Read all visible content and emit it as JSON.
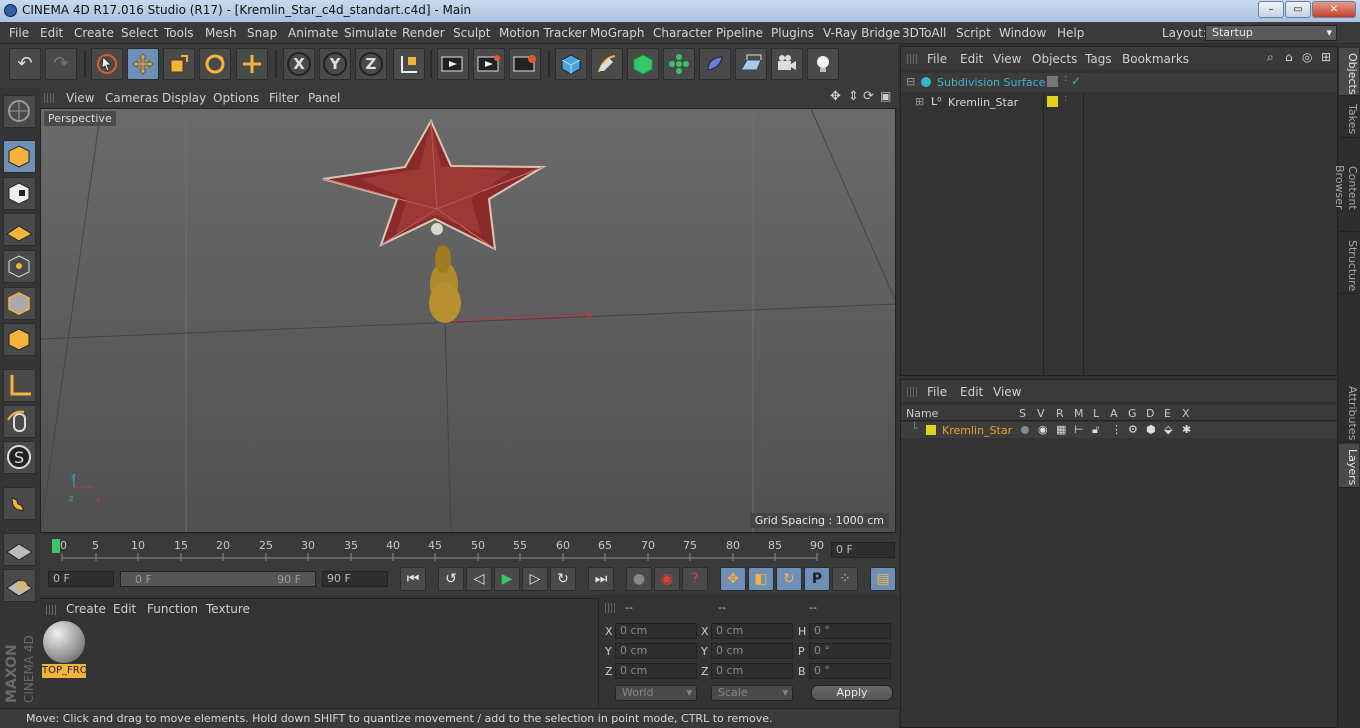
{
  "title": "CINEMA 4D R17.016 Studio (R17) - [Kremlin_Star_c4d_standart.c4d] - Main",
  "menu": [
    "File",
    "Edit",
    "Create",
    "Select",
    "Tools",
    "Mesh",
    "Snap",
    "Animate",
    "Simulate",
    "Render",
    "Sculpt",
    "Motion Tracker",
    "MoGraph",
    "Character",
    "Pipeline",
    "Plugins",
    "V-Ray Bridge",
    "3DToAll",
    "Script",
    "Window",
    "Help"
  ],
  "layout": {
    "label": "Layout:",
    "value": "Startup"
  },
  "toolbar_icons": [
    "undo-icon",
    "redo-icon",
    "live-selection-icon",
    "move-icon",
    "scale-icon",
    "rotate-icon",
    "recent-tool-icon",
    "x-axis-icon",
    "y-axis-icon",
    "z-axis-icon",
    "coordinate-system-icon",
    "render-view-icon",
    "render-picture-viewer-icon",
    "render-settings-icon",
    "cube-icon",
    "pen-icon",
    "subdivision-icon",
    "array-icon",
    "deformer-icon",
    "floor-icon",
    "camera-icon",
    "light-icon"
  ],
  "axis_labels": [
    "X",
    "Y",
    "Z"
  ],
  "viewport": {
    "menu": [
      "View",
      "Cameras",
      "Display",
      "Options",
      "Filter",
      "Panel"
    ],
    "label": "Perspective",
    "grid_spacing": "Grid Spacing : 1000 cm"
  },
  "timeline": {
    "ticks": [
      "0",
      "5",
      "10",
      "15",
      "20",
      "25",
      "30",
      "35",
      "40",
      "45",
      "50",
      "55",
      "60",
      "65",
      "70",
      "75",
      "80",
      "85",
      "90"
    ],
    "current_frame": "0 F"
  },
  "transport": {
    "start": "0 F",
    "range_start": "0 F",
    "range_end": "90 F",
    "end": "90 F"
  },
  "material_panel": {
    "menu": [
      "Create",
      "Edit",
      "Function",
      "Texture"
    ],
    "material_name": "TOP_FRO"
  },
  "coords": {
    "headers": [
      "--",
      "--",
      "--"
    ],
    "rows": [
      {
        "a": "X",
        "av": "0 cm",
        "b": "X",
        "bv": "0 cm",
        "c": "H",
        "cv": "0 °"
      },
      {
        "a": "Y",
        "av": "0 cm",
        "b": "Y",
        "bv": "0 cm",
        "c": "P",
        "cv": "0 °"
      },
      {
        "a": "Z",
        "av": "0 cm",
        "b": "Z",
        "bv": "0 cm",
        "c": "B",
        "cv": "0 °"
      }
    ],
    "world": "World",
    "scale": "Scale",
    "apply": "Apply"
  },
  "status": "Move: Click and drag to move elements. Hold down SHIFT to quantize movement / add to the selection in point mode, CTRL to remove.",
  "objects_panel": {
    "menu": [
      "File",
      "Edit",
      "View",
      "Objects",
      "Tags",
      "Bookmarks"
    ],
    "items": [
      {
        "name": "Subdivision Surface",
        "color": "#39b8c9"
      },
      {
        "name": "Kremlin_Star",
        "color": "#d9d9d9"
      }
    ]
  },
  "layers_panel": {
    "menu": [
      "File",
      "Edit",
      "View"
    ],
    "columns": [
      "Name",
      "S",
      "V",
      "R",
      "M",
      "L",
      "A",
      "G",
      "D",
      "E",
      "X"
    ],
    "layer": {
      "name": "Kremlin_Star",
      "color": "#e0d020"
    }
  },
  "right_tabs": [
    "Objects",
    "Takes",
    "Content Browser",
    "Structure",
    "Attributes",
    "Layers"
  ],
  "brand": {
    "line1": "MAXON",
    "line2": "CINEMA 4D"
  },
  "colors": {
    "accent": "#6d8fb8",
    "layer_text": "#f0a020",
    "teal": "#39b8c9"
  }
}
